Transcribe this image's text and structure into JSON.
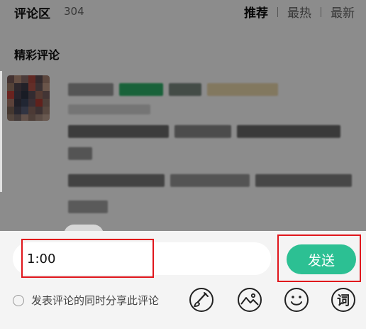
{
  "header": {
    "title": "评论区",
    "count": "304",
    "sort_tabs": [
      {
        "label": "推荐",
        "active": true
      },
      {
        "label": "最热",
        "active": false
      },
      {
        "label": "最新",
        "active": false
      }
    ]
  },
  "section_title": "精彩评论",
  "composer": {
    "input_value": "1:00",
    "send_label": "发送",
    "share_label": "发表评论的同时分享此评论",
    "share_checked": false,
    "tools": [
      {
        "name": "brush-icon"
      },
      {
        "name": "image-icon"
      },
      {
        "name": "emoji-icon"
      },
      {
        "name": "word-icon",
        "label": "词"
      }
    ]
  },
  "colors": {
    "accent": "#2cc093",
    "highlight": "#e0161c",
    "overlay": "rgba(0,0,0,0.45)"
  }
}
